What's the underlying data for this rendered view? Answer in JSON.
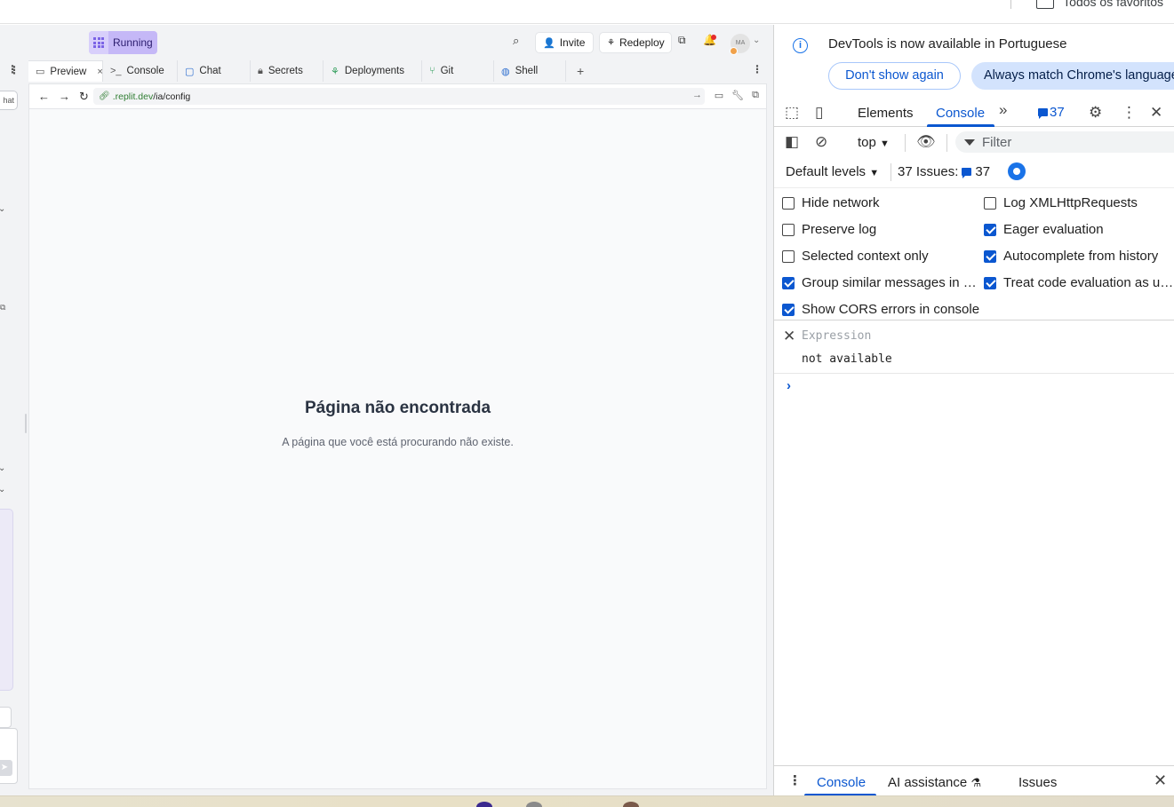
{
  "browser": {
    "bookmark_folder": "Todos os favoritos"
  },
  "replit": {
    "status_label": "Running",
    "invite_label": "Invite",
    "redeploy_label": "Redeploy",
    "avatar_initials": "MA",
    "left_pill_label": "hat",
    "tabs": [
      {
        "label": "Preview",
        "icon": "monitor-icon",
        "active": true
      },
      {
        "label": "Console",
        "icon": "terminal-icon"
      },
      {
        "label": "Chat",
        "icon": "chat-icon"
      },
      {
        "label": "Secrets",
        "icon": "lock-icon"
      },
      {
        "label": "Deployments",
        "icon": "deploy-icon"
      },
      {
        "label": "Git",
        "icon": "git-icon"
      },
      {
        "label": "Shell",
        "icon": "shell-icon"
      }
    ],
    "url": {
      "domain": ".replit.dev",
      "path": "/ia/config"
    },
    "page": {
      "title": "Página não encontrada",
      "description": "A página que você está procurando não existe."
    }
  },
  "devtools": {
    "infobar": {
      "message": "DevTools is now available in Portuguese",
      "dismiss_label": "Don't show again",
      "match_label": "Always match Chrome's language"
    },
    "tabs": {
      "elements": "Elements",
      "console": "Console",
      "issues_badge": "37"
    },
    "console_toolbar": {
      "context": "top",
      "filter_placeholder": "Filter",
      "levels": "Default levels",
      "issues_label": "37 Issues:",
      "issues_count": "37"
    },
    "settings": {
      "left": [
        {
          "label": "Hide network",
          "checked": false
        },
        {
          "label": "Preserve log",
          "checked": false
        },
        {
          "label": "Selected context only",
          "checked": false
        },
        {
          "label": "Group similar messages in console",
          "checked": true
        },
        {
          "label": "Show CORS errors in console",
          "checked": true
        }
      ],
      "right": [
        {
          "label": "Log XMLHttpRequests",
          "checked": false
        },
        {
          "label": "Eager evaluation",
          "checked": true
        },
        {
          "label": "Autocomplete from history",
          "checked": true
        },
        {
          "label": "Treat code evaluation as user action",
          "checked": true
        }
      ]
    },
    "expression": {
      "placeholder": "Expression",
      "value": "not available"
    },
    "drawer": {
      "console": "Console",
      "ai_assistance": "AI assistance",
      "issues": "Issues"
    }
  },
  "colors": {
    "accent_blue": "#0b57d0",
    "running_badge": "#c5b8f7",
    "replit_domain": "#2f7d32"
  }
}
